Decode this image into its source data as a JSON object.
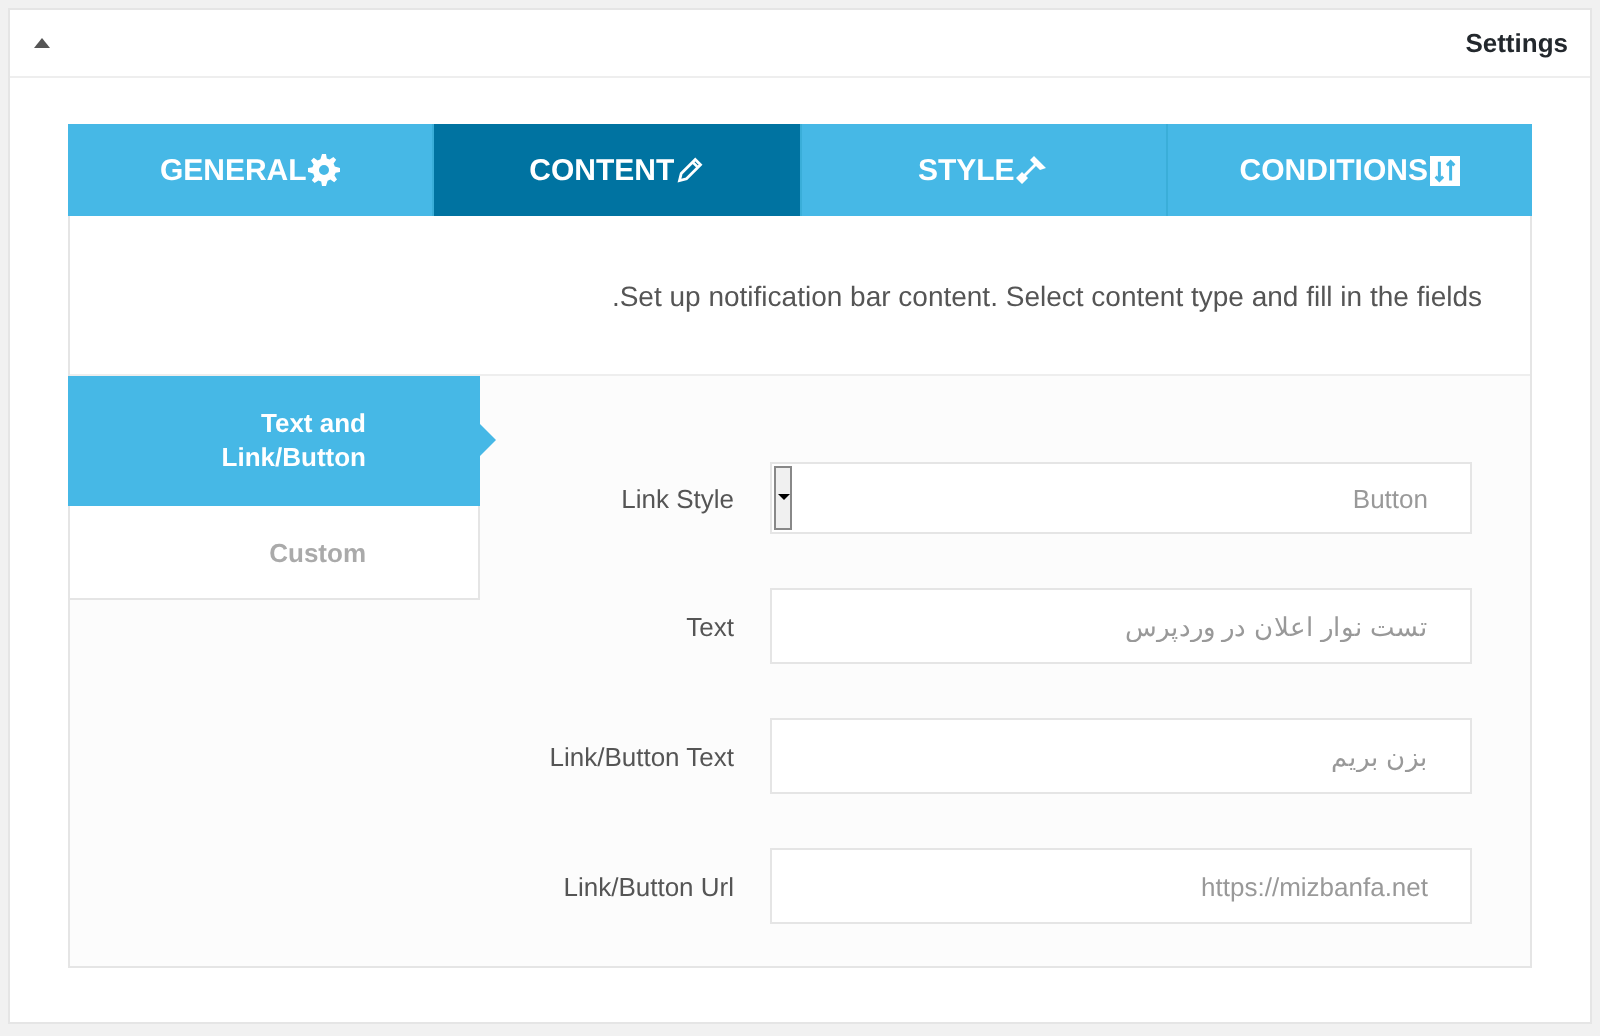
{
  "panel": {
    "title": "Settings",
    "expanded": true
  },
  "tabs": [
    {
      "label": "GENERAL",
      "selected": false
    },
    {
      "label": "CONTENT",
      "selected": true
    },
    {
      "label": "STYLE",
      "selected": false
    },
    {
      "label": "CONDITIONS",
      "selected": false
    }
  ],
  "description": ".Set up notification bar content. Select content type and fill in the fields",
  "content_types": [
    {
      "label": "Text and Link/Button",
      "selected": true
    },
    {
      "label": "Custom",
      "selected": false
    }
  ],
  "fields": [
    {
      "label": "Link Style",
      "kind": "select",
      "value": "Button"
    },
    {
      "label": "Text",
      "kind": "text",
      "value": "تست نوار اعلان در وردپرس"
    },
    {
      "label": "Link/Button Text",
      "kind": "text",
      "value": "بزن بریم"
    },
    {
      "label": "Link/Button Url",
      "kind": "text",
      "value": "https://mizbanfa.net"
    }
  ]
}
